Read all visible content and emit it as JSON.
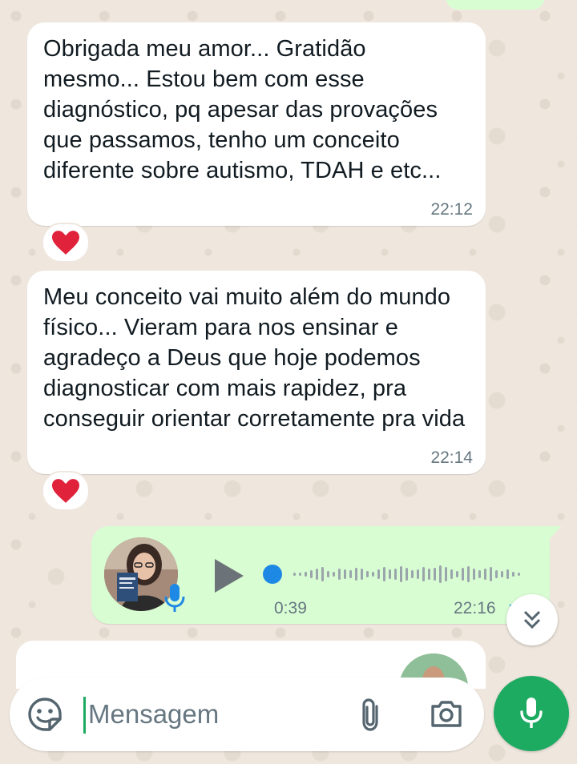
{
  "messages": [
    {
      "direction": "incoming",
      "text": "Obrigada meu amor... Gratidão mesmo... Estou bem com esse diagnóstico, pq apesar das provações que passamos, tenho um conceito diferente sobre autismo, TDAH e etc...",
      "time": "22:12",
      "reaction": "heart"
    },
    {
      "direction": "incoming",
      "text": "Meu conceito vai muito além do mundo físico... Vieram para nos ensinar e agradeço a Deus que hoje podemos diagnosticar com mais rapidez, pra conseguir orientar corretamente pra vida",
      "time": "22:14",
      "reaction": "heart"
    },
    {
      "direction": "outgoing",
      "type": "voice",
      "duration": "0:39",
      "time": "22:16",
      "progress": 0
    }
  ],
  "composer": {
    "placeholder": "Mensagem"
  },
  "icons": {
    "reaction": "heart-icon",
    "play": "play-icon",
    "voice_mic": "microphone-icon",
    "scroll": "double-chevron-down-icon",
    "sticker": "sticker-icon",
    "attach": "paperclip-icon",
    "camera": "camera-icon",
    "send_voice": "microphone-icon"
  },
  "colors": {
    "incoming_bubble": "#ffffff",
    "outgoing_bubble": "#d9fdd3",
    "accent_green": "#1daa61",
    "voice_progress_dot": "#1e88e5",
    "heart": "#e0223a",
    "read_ticks": "#53bdeb",
    "wallpaper": "#efe7de"
  }
}
